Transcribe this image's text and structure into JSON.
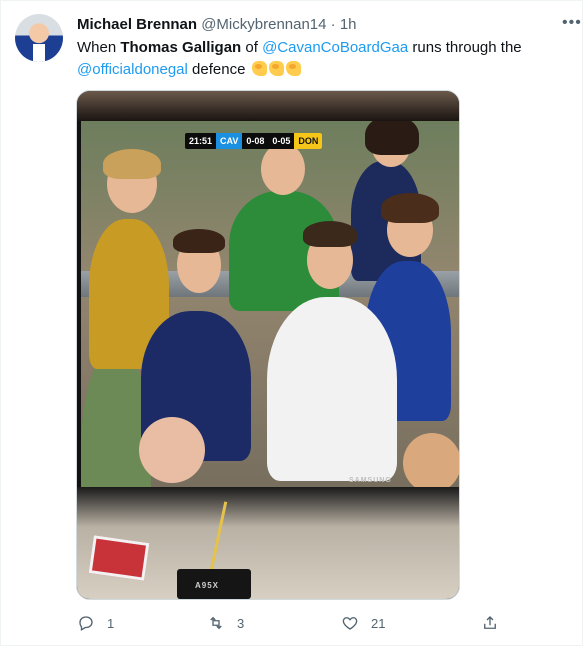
{
  "tweet": {
    "author_name": "Michael Brennan",
    "author_handle": "@Mickybrennan14",
    "separator": "·",
    "time": "1h",
    "text": {
      "part1": "When ",
      "player": "Thomas Galligan",
      "part2": " of ",
      "mention1": "@CavanCoBoardGaa",
      "part3": " runs through the ",
      "mention2": "@officialdonegal",
      "part4": " defence"
    },
    "emoji_icons": [
      "flexed-biceps-icon",
      "flexed-biceps-icon",
      "flexed-biceps-icon"
    ]
  },
  "media": {
    "scoreboard": {
      "clock": "21:51",
      "team1": "CAV",
      "score1": "0-08",
      "score2": "0-05",
      "team2": "DON"
    },
    "tv_brand": "SAMSUNG",
    "box_label": "A95X"
  },
  "actions": {
    "reply_count": "1",
    "retweet_count": "3",
    "like_count": "21",
    "share_count": ""
  },
  "colors": {
    "accent": "#1d9bf0",
    "muted": "#536471",
    "cavan_blue": "#1b8fe0",
    "donegal_yellow": "#f5c518"
  }
}
